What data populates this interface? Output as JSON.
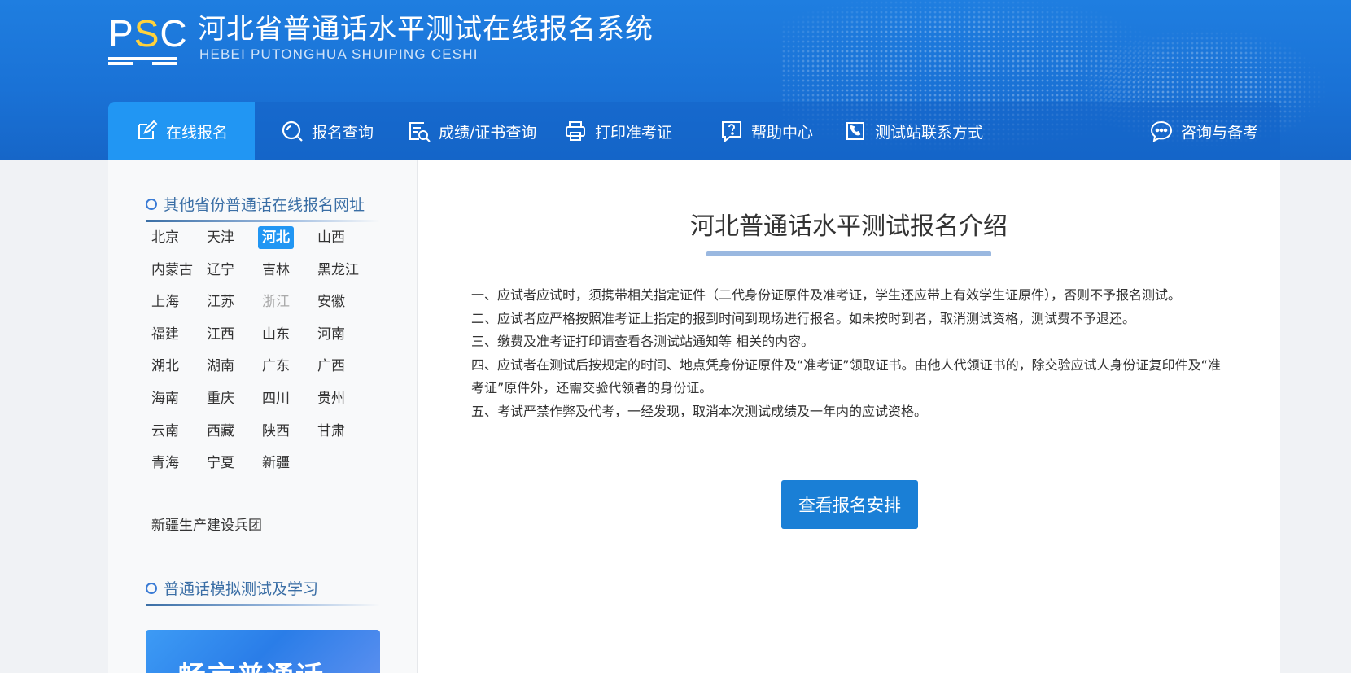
{
  "header": {
    "logo": "PSC",
    "title": "河北省普通话水平测试在线报名系统",
    "subtitle": "HEBEI PUTONGHUA SHUIPING CESHI"
  },
  "nav": {
    "items": [
      {
        "label": "在线报名",
        "icon": "edit-icon",
        "active": true
      },
      {
        "label": "报名查询",
        "icon": "search-icon"
      },
      {
        "label": "成绩/证书查询",
        "icon": "certificate-search-icon"
      },
      {
        "label": "打印准考证",
        "icon": "printer-icon"
      },
      {
        "label": "帮助中心",
        "icon": "help-icon"
      },
      {
        "label": "测试站联系方式",
        "icon": "phone-contact-icon"
      },
      {
        "label": "咨询与备考",
        "icon": "chat-icon"
      }
    ]
  },
  "sidebar": {
    "provinces_heading": "其他省份普通话在线报名网址",
    "provinces": [
      "北京",
      "天津",
      "河北",
      "山西",
      "内蒙古",
      "辽宁",
      "吉林",
      "黑龙江",
      "上海",
      "江苏",
      "浙江",
      "安徽",
      "福建",
      "江西",
      "山东",
      "河南",
      "湖北",
      "湖南",
      "广东",
      "广西",
      "海南",
      "重庆",
      "四川",
      "贵州",
      "云南",
      "西藏",
      "陕西",
      "甘肃",
      "青海",
      "宁夏",
      "新疆"
    ],
    "active_province": "河北",
    "dimmed_province": "浙江",
    "extra_region": "新疆生产建设兵团",
    "study_heading": "普通话模拟测试及学习",
    "banner_text": "畅言普通话"
  },
  "content": {
    "title": "河北普通话水平测试报名介绍",
    "rules": [
      "一、应试者应试时，须携带相关指定证件（二代身份证原件及准考证，学生还应带上有效学生证原件），否则不予报名测试。",
      "二、应试者应严格按照准考证上指定的报到时间到现场进行报名。如未按时到者，取消测试资格，测试费不予退还。",
      "三、缴费及准考证打印请查看各测试站通知等 相关的内容。",
      "四、应试者在测试后按规定的时间、地点凭身份证原件及“准考证”领取证书。由他人代领证书的，除交验应试人身份证复印件及“准考证”原件外，还需交验代领者的身份证。",
      "五、考试严禁作弊及代考，一经发现，取消本次测试成绩及一年内的应试资格。"
    ],
    "cta_label": "查看报名安排"
  },
  "colors": {
    "header_blue": "#1f7ee0",
    "nav_active": "#2196f3",
    "button_blue": "#1a7fd6",
    "heading_blue": "#3a6ea5"
  }
}
